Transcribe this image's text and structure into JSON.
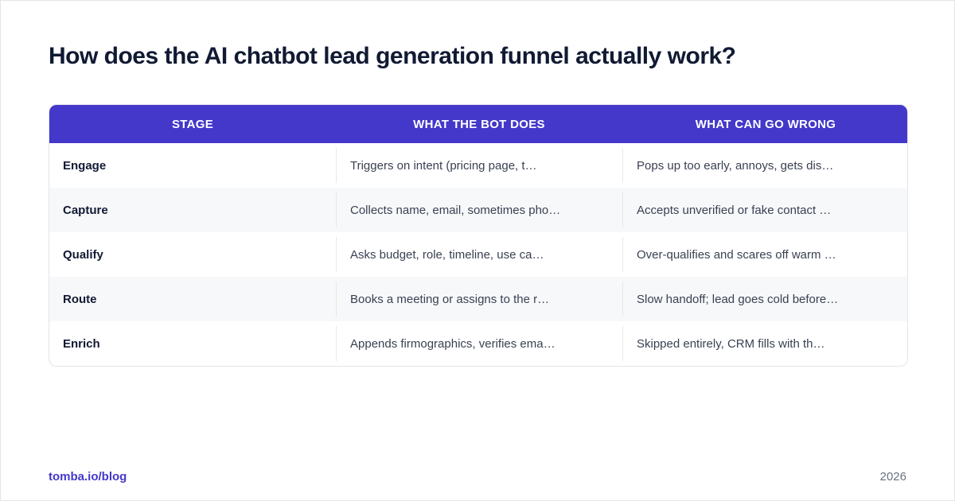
{
  "title": "How does the AI chatbot lead generation funnel actually work?",
  "table": {
    "headers": [
      "STAGE",
      "WHAT THE BOT DOES",
      "WHAT CAN GO WRONG"
    ],
    "rows": [
      {
        "stage": "Engage",
        "does": "Triggers on intent (pricing page, t…",
        "wrong": "Pops up too early, annoys, gets dis…"
      },
      {
        "stage": "Capture",
        "does": "Collects name, email, sometimes pho…",
        "wrong": "Accepts unverified or fake contact …"
      },
      {
        "stage": "Qualify",
        "does": "Asks budget, role, timeline, use ca…",
        "wrong": "Over-qualifies and scares off warm …"
      },
      {
        "stage": "Route",
        "does": "Books a meeting or assigns to the r…",
        "wrong": "Slow handoff; lead goes cold before…"
      },
      {
        "stage": "Enrich",
        "does": "Appends firmographics, verifies ema…",
        "wrong": "Skipped entirely, CRM fills with th…"
      }
    ]
  },
  "footer": {
    "source": "tomba.io/blog",
    "year": "2026"
  },
  "colors": {
    "header_bg": "#4338ca",
    "title": "#111a33",
    "accent": "#4338ca"
  }
}
